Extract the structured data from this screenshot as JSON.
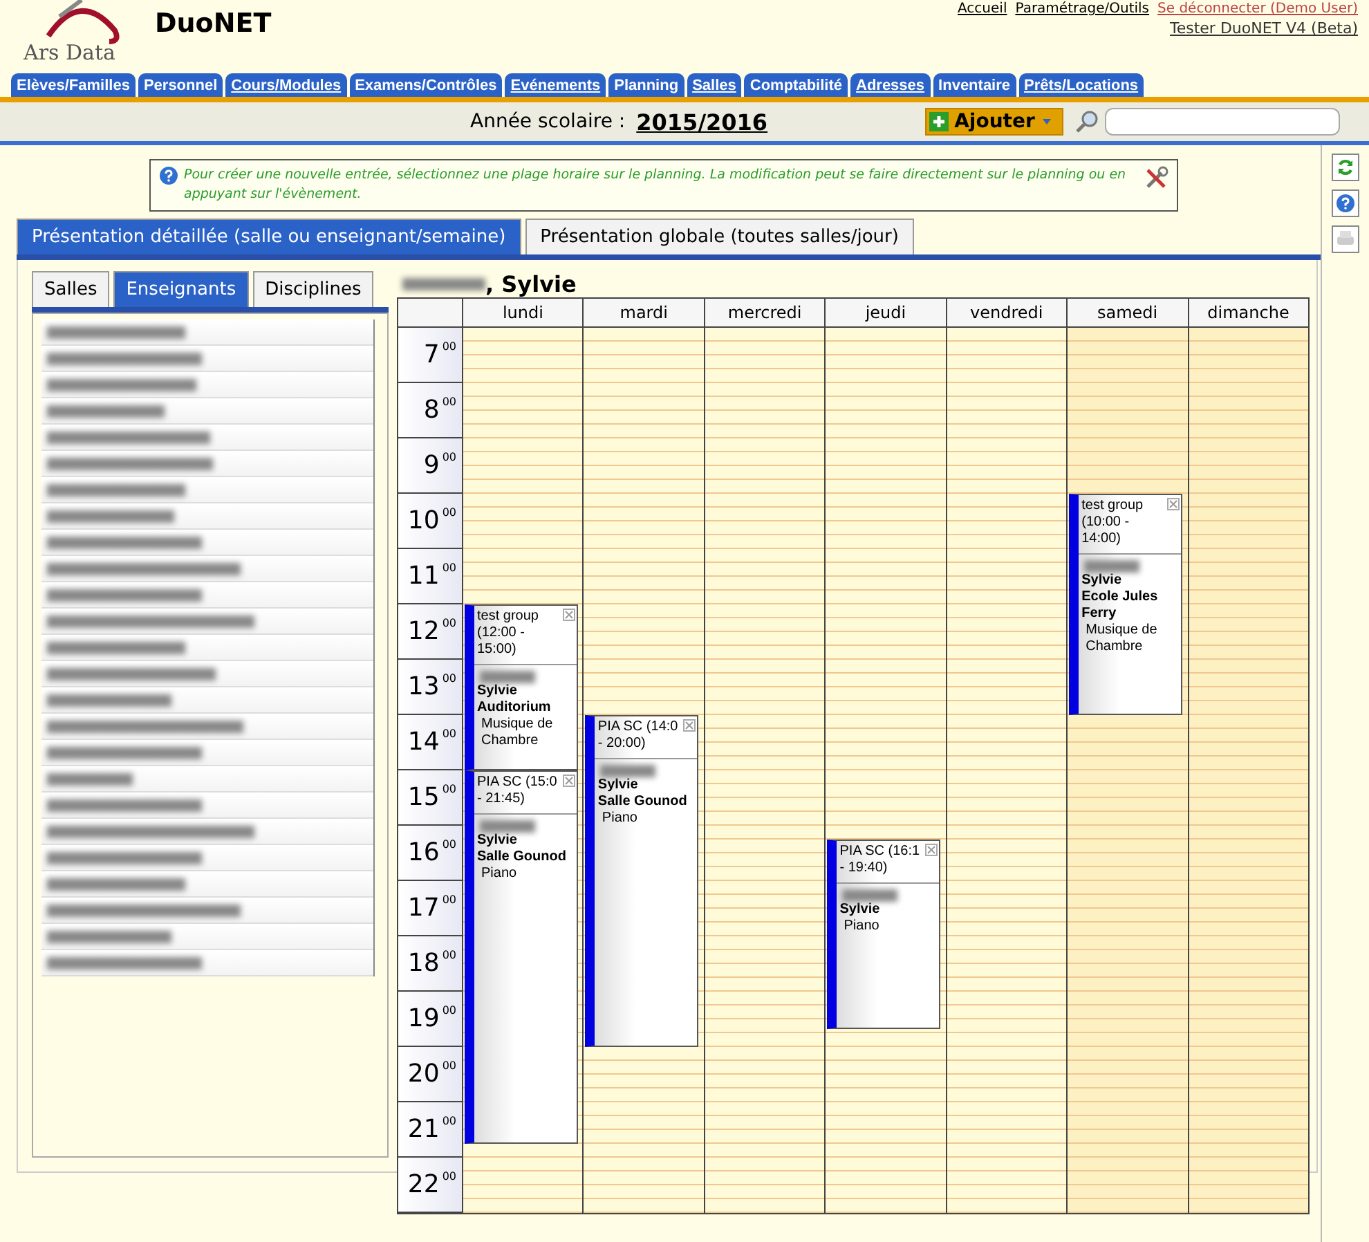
{
  "app": {
    "brand": "Ars Data",
    "title": "DuoNET",
    "top_links": [
      "Accueil",
      "Paramétrage/Outils",
      "Se déconnecter (Demo User)"
    ],
    "user": "Tester DuoNET V4 (Beta)"
  },
  "main_tabs": [
    {
      "label": "Elèves/Familles",
      "link": false
    },
    {
      "label": "Personnel",
      "link": false
    },
    {
      "label": "Cours/Modules",
      "link": true
    },
    {
      "label": "Examens/Contrôles",
      "link": false
    },
    {
      "label": "Evénements",
      "link": true
    },
    {
      "label": "Planning",
      "link": false
    },
    {
      "label": "Salles",
      "link": true
    },
    {
      "label": "Comptabilité",
      "link": false
    },
    {
      "label": "Adresses",
      "link": true
    },
    {
      "label": "Inventaire",
      "link": false
    },
    {
      "label": "Prêts/Locations",
      "link": true
    }
  ],
  "toolbar": {
    "year_label": "Année scolaire :",
    "year": "2015/2016",
    "add_button": "Ajouter"
  },
  "info": "Pour créer une nouvelle entrée, sélectionnez une plage horaire sur le planning. La modification peut se faire directement sur le planning ou en appuyant sur l'évènement.",
  "view_tabs": [
    {
      "label": "Présentation détaillée (salle ou enseignant/semaine)",
      "selected": true
    },
    {
      "label": "Présentation globale (toutes salles/jour)",
      "selected": false
    }
  ],
  "list_tabs": [
    {
      "label": "Salles",
      "selected": false
    },
    {
      "label": "Enseignants",
      "selected": true
    },
    {
      "label": "Disciplines",
      "selected": false
    }
  ],
  "calendar": {
    "heading": ", Sylvie",
    "days": [
      {
        "label": "lundi",
        "weekend": false,
        "events": [
          {
            "title_lines": [
              "test group",
              "(12:00 -",
              "15:00)"
            ],
            "name": "Sylvie",
            "location": "Auditorium",
            "subject": "Musique de Chambre"
          },
          {
            "title_lines": [
              "PIA SC (15:0",
              "- 21:45)"
            ],
            "name": "Sylvie",
            "location": "Salle Gounod",
            "subject": "Piano"
          }
        ]
      },
      {
        "label": "mardi",
        "weekend": false,
        "events": [
          {
            "title_lines": [
              "PIA SC (14:0",
              "- 20:00)"
            ],
            "name": "Sylvie",
            "location": "Salle Gounod",
            "subject": "Piano"
          }
        ]
      },
      {
        "label": "mercredi",
        "weekend": false
      },
      {
        "label": "jeudi",
        "weekend": false,
        "events": [
          {
            "title_lines": [
              "PIA SC (16:1",
              "- 19:40)"
            ],
            "name": "Sylvie",
            "subject": "Piano"
          }
        ]
      },
      {
        "label": "vendredi",
        "weekend": false
      },
      {
        "label": "samedi",
        "weekend": true,
        "events": [
          {
            "title_lines": [
              "test group",
              "(10:00 -",
              "14:00)"
            ],
            "name": "Sylvie",
            "location": "Ecole Jules Ferry",
            "subject": "Musique de Chambre"
          }
        ]
      },
      {
        "label": "dimanche",
        "weekend": true
      }
    ],
    "hours": [
      {
        "hour": "7",
        "minutes": "00"
      },
      {
        "hour": "8",
        "minutes": "00"
      },
      {
        "hour": "9",
        "minutes": "00"
      },
      {
        "hour": "10",
        "minutes": "00"
      },
      {
        "hour": "11",
        "minutes": "00"
      },
      {
        "hour": "12",
        "minutes": "00"
      },
      {
        "hour": "13",
        "minutes": "00"
      },
      {
        "hour": "14",
        "minutes": "00"
      },
      {
        "hour": "15",
        "minutes": "00"
      },
      {
        "hour": "16",
        "minutes": "00"
      },
      {
        "hour": "17",
        "minutes": "00"
      },
      {
        "hour": "18",
        "minutes": "00"
      },
      {
        "hour": "19",
        "minutes": "00"
      },
      {
        "hour": "20",
        "minutes": "00"
      },
      {
        "hour": "21",
        "minutes": "00"
      },
      {
        "hour": "22",
        "minutes": "00"
      }
    ]
  }
}
